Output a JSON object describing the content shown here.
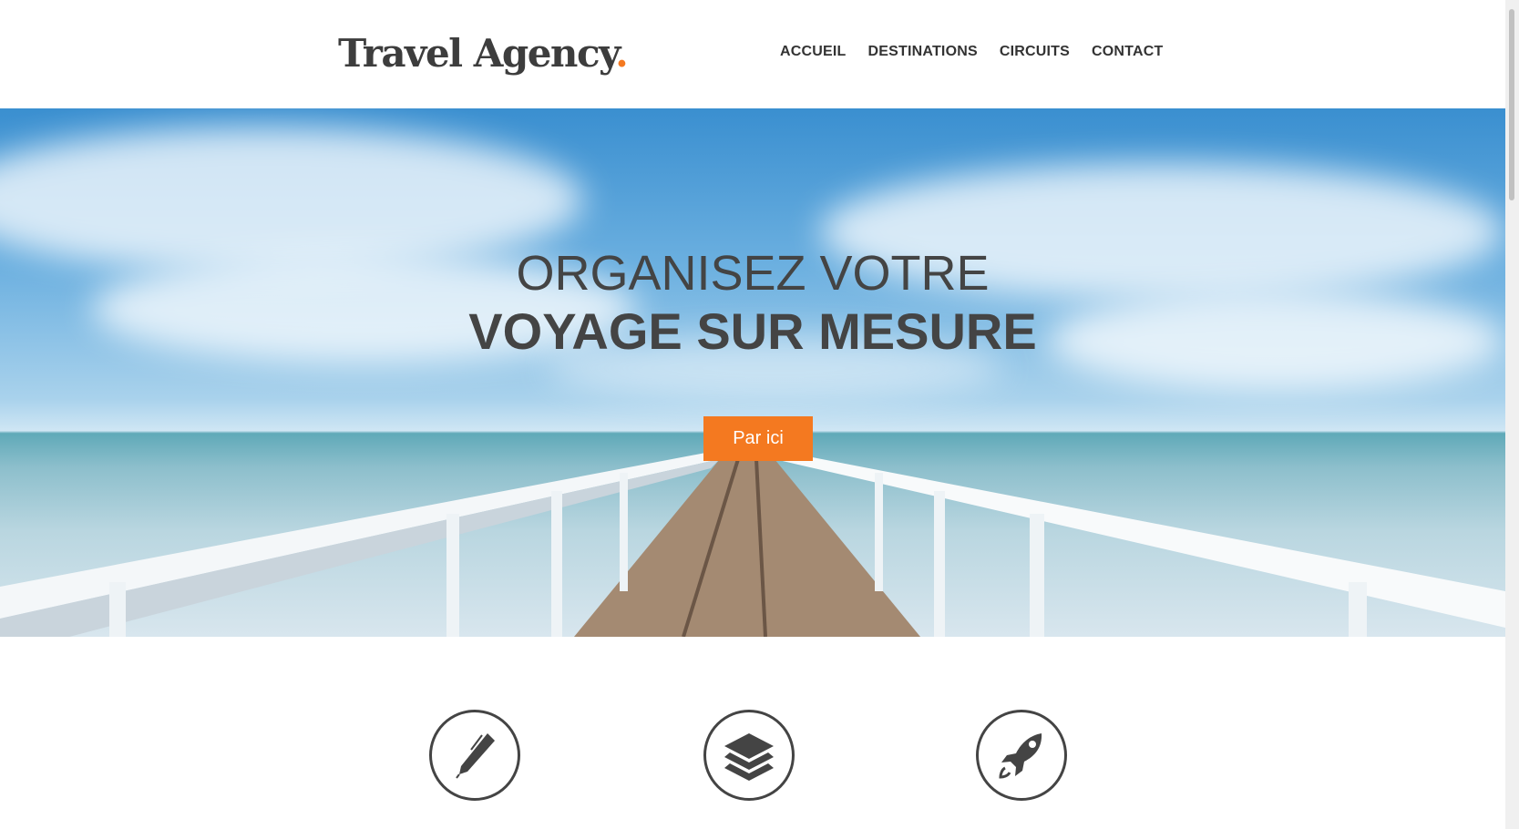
{
  "header": {
    "logo_text": "Travel Agency",
    "logo_dot": ".",
    "nav": [
      {
        "label": "ACCUEIL"
      },
      {
        "label": "DESTINATIONS"
      },
      {
        "label": "CIRCUITS"
      },
      {
        "label": "CONTACT"
      }
    ]
  },
  "hero": {
    "line1": "ORGANISEZ VOTRE",
    "line2": "VOYAGE SUR MESURE",
    "cta_label": "Par ici"
  },
  "features": [
    {
      "icon": "pencil-icon"
    },
    {
      "icon": "layers-icon"
    },
    {
      "icon": "rocket-icon"
    }
  ],
  "colors": {
    "accent": "#f47920",
    "text": "#444444"
  }
}
